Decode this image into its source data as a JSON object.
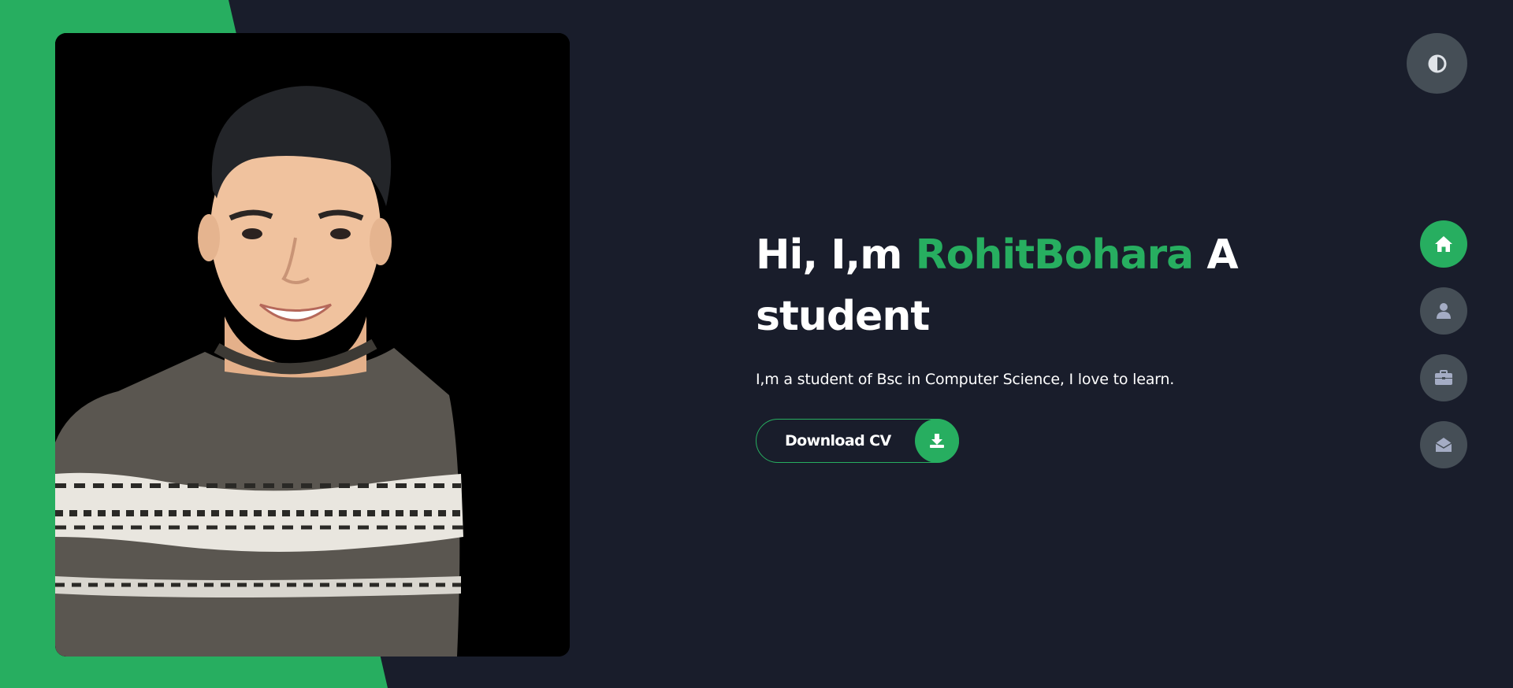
{
  "hero": {
    "greeting": "Hi, I,m ",
    "name": "RohitBohara",
    "role": " A student",
    "description": "I,m a student of Bsc in Computer Science, I love to learn.",
    "cv_button_label": "Download CV"
  },
  "icons": {
    "theme_toggle": "contrast-icon",
    "download": "download-icon",
    "nav": [
      "home-icon",
      "user-icon",
      "briefcase-icon",
      "envelope-open-icon"
    ]
  },
  "nav": {
    "active_index": 0
  },
  "colors": {
    "background": "#191d2b",
    "accent": "#27ae60",
    "nav_button": "#454e56",
    "nav_icon": "#a4acc4",
    "text": "#ffffff"
  }
}
